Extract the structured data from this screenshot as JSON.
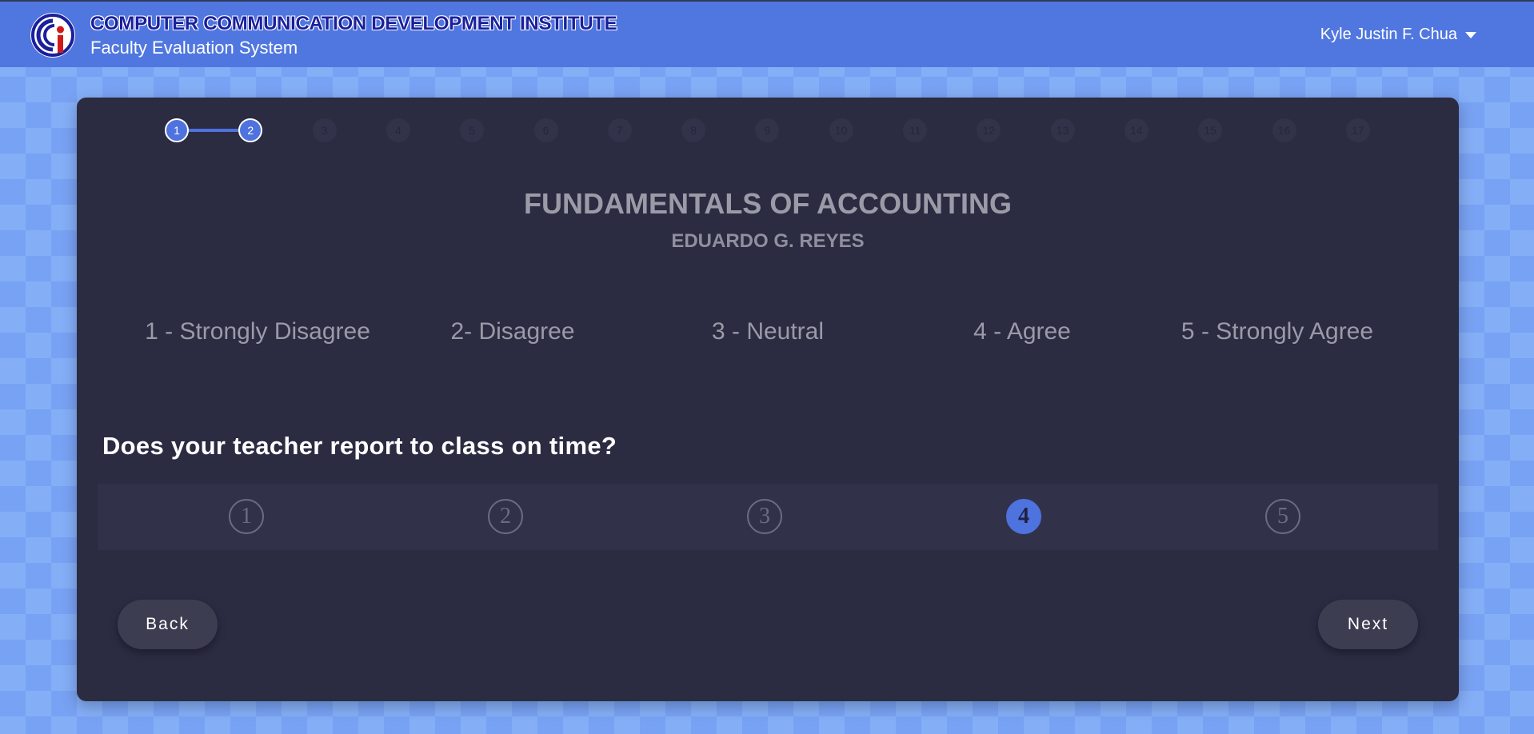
{
  "header": {
    "institution": "COMPUTER COMMUNICATION DEVELOPMENT INSTITUTE",
    "system": "Faculty Evaluation System",
    "user": "Kyle Justin F. Chua",
    "colors": {
      "bar": "#5077e0",
      "accent": "#4e72de"
    }
  },
  "progress": {
    "current": 2,
    "total": 17,
    "steps": [
      "1",
      "2",
      "3",
      "4",
      "5",
      "6",
      "7",
      "8",
      "9",
      "10",
      "11",
      "12",
      "13",
      "14",
      "15",
      "16",
      "17"
    ]
  },
  "evaluation": {
    "course": "FUNDAMENTALS OF ACCOUNTING",
    "teacher": "EDUARDO G. REYES",
    "scale": [
      "1 - Strongly Disagree",
      "2- Disagree",
      "3 - Neutral",
      "4 - Agree",
      "5 - Strongly Agree"
    ],
    "question": "Does your teacher report to class on time?",
    "options": [
      "1",
      "2",
      "3",
      "4",
      "5"
    ],
    "selected": "4"
  },
  "nav": {
    "back": "Back",
    "next": "Next"
  }
}
